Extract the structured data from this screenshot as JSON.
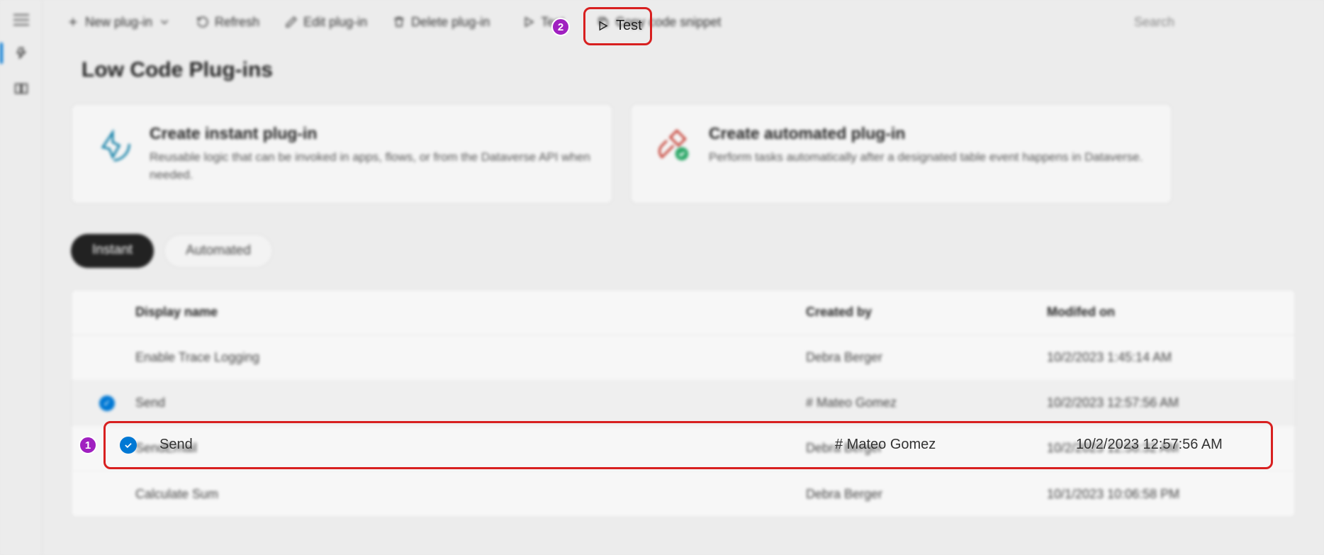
{
  "toolbar": {
    "new_plugin": "New plug-in",
    "refresh": "Refresh",
    "edit_plugin": "Edit plug-in",
    "delete_plugin": "Delete plug-in",
    "test": "Test",
    "copy_snippet": "Copy code snippet",
    "search_placeholder": "Search"
  },
  "page": {
    "title": "Low Code Plug-ins"
  },
  "cards": {
    "instant": {
      "title": "Create instant plug-in",
      "desc": "Reusable logic that can be invoked in apps, flows, or from the Dataverse API when needed."
    },
    "automated": {
      "title": "Create automated plug-in",
      "desc": "Perform tasks automatically after a designated table event happens in Dataverse."
    }
  },
  "tabs": {
    "instant": "Instant",
    "automated": "Automated"
  },
  "table": {
    "headers": {
      "display_name": "Display name",
      "created_by": "Created by",
      "modified_on": "Modifed on"
    },
    "rows": [
      {
        "display_name": "Enable Trace Logging",
        "created_by": "Debra Berger",
        "modified_on": "10/2/2023 1:45:14 AM",
        "selected": false
      },
      {
        "display_name": "Send",
        "created_by": "# Mateo Gomez",
        "modified_on": "10/2/2023 12:57:56 AM",
        "selected": true
      },
      {
        "display_name": "SendEmail",
        "created_by": "Debra Berger",
        "modified_on": "10/2/2023 12:56:32 AM",
        "selected": false
      },
      {
        "display_name": "Calculate Sum",
        "created_by": "Debra Berger",
        "modified_on": "10/1/2023 10:06:58 PM",
        "selected": false
      }
    ]
  },
  "callouts": {
    "one": "1",
    "two": "2"
  }
}
